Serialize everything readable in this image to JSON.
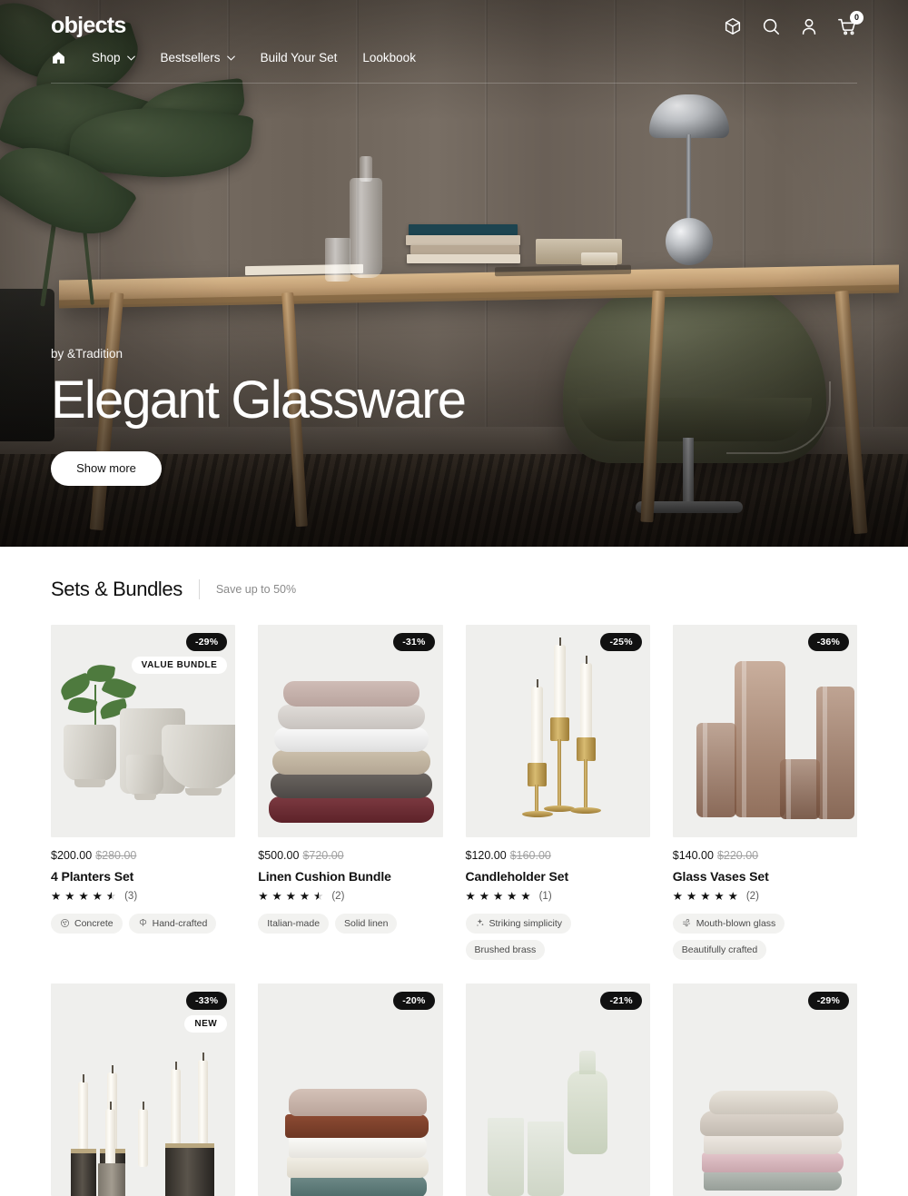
{
  "header": {
    "brand": "objects",
    "icons": [
      {
        "name": "package-icon",
        "label": "Package"
      },
      {
        "name": "search-icon",
        "label": "Search"
      },
      {
        "name": "account-icon",
        "label": "Account"
      },
      {
        "name": "cart-icon",
        "label": "Cart"
      }
    ],
    "cart_count": "0",
    "nav": [
      {
        "label": "Shop",
        "has_dropdown": true
      },
      {
        "label": "Bestsellers",
        "has_dropdown": true
      },
      {
        "label": "Build Your Set",
        "has_dropdown": false
      },
      {
        "label": "Lookbook",
        "has_dropdown": false
      }
    ]
  },
  "hero": {
    "eyebrow": "by &Tradition",
    "title": "Elegant Glassware",
    "button": "Show more"
  },
  "section": {
    "title": "Sets & Bundles",
    "subtitle": "Save up to 50%"
  },
  "products": [
    {
      "discount": "-29%",
      "tag_badge": "VALUE BUNDLE",
      "price": "$200.00",
      "price_old": "$280.00",
      "title": "4 Planters Set",
      "stars": "★ ★ ★ ★ ★",
      "rating": 4.5,
      "reviews": "(3)",
      "tags": [
        {
          "label": "Concrete",
          "icon": "concrete-icon"
        },
        {
          "label": "Hand-crafted",
          "icon": "handcraft-icon"
        }
      ]
    },
    {
      "discount": "-31%",
      "tag_badge": "",
      "price": "$500.00",
      "price_old": "$720.00",
      "title": "Linen Cushion Bundle",
      "stars": "★ ★ ★ ★ ★",
      "rating": 4.5,
      "reviews": "(2)",
      "tags": [
        {
          "label": "Italian-made",
          "icon": ""
        },
        {
          "label": "Solid linen",
          "icon": ""
        }
      ]
    },
    {
      "discount": "-25%",
      "tag_badge": "",
      "price": "$120.00",
      "price_old": "$160.00",
      "title": "Candleholder Set",
      "stars": "★ ★ ★ ★ ★",
      "rating": 5,
      "reviews": "(1)",
      "tags": [
        {
          "label": "Striking simplicity",
          "icon": "sparkle-icon"
        },
        {
          "label": "Brushed brass",
          "icon": ""
        }
      ]
    },
    {
      "discount": "-36%",
      "tag_badge": "",
      "price": "$140.00",
      "price_old": "$220.00",
      "title": "Glass Vases Set",
      "stars": "★ ★ ★ ★ ★",
      "rating": 5,
      "reviews": "(2)",
      "tags": [
        {
          "label": "Mouth-blown glass",
          "icon": "blow-icon"
        },
        {
          "label": "Beautifully crafted",
          "icon": ""
        }
      ]
    },
    {
      "discount": "-33%",
      "tag_badge": "NEW"
    },
    {
      "discount": "-20%",
      "tag_badge": ""
    },
    {
      "discount": "-21%",
      "tag_badge": ""
    },
    {
      "discount": "-29%",
      "tag_badge": ""
    }
  ],
  "colors": {
    "badge_bg": "#111111",
    "badge_text": "#ffffff",
    "card_bg": "#efefed",
    "page_bg": "#ffffff",
    "text": "#111111",
    "muted": "#8a8a8a"
  }
}
